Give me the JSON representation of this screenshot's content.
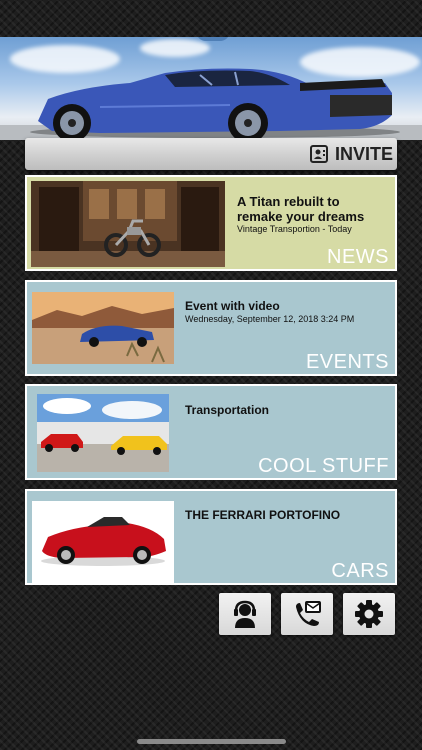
{
  "header": {
    "invite_label": "INVITE"
  },
  "feed": [
    {
      "title": "A Titan rebuilt to remake your dreams",
      "subtitle": "Vintage Transportion - Today",
      "section": "NEWS",
      "bg": "#d6dba5",
      "thumb": "motorcycle-garage-image"
    },
    {
      "title": "Event with video",
      "subtitle": "Wednesday, September 12, 2018 3:24 PM",
      "section": "EVENTS",
      "bg": "#a9c7cf",
      "thumb": "desert-supercar-image"
    },
    {
      "title": "Transportation",
      "subtitle": "",
      "section": "COOL STUFF",
      "bg": "#a9c7cf",
      "thumb": "race-cars-image"
    },
    {
      "title": "THE FERRARI PORTOFINO",
      "subtitle": "",
      "section": "CARS",
      "bg": "#a9c7cf",
      "thumb": "red-ferrari-image"
    }
  ],
  "actions": [
    {
      "icon": "headset-support-icon"
    },
    {
      "icon": "phone-mail-icon"
    },
    {
      "icon": "gear-icon"
    }
  ],
  "colors": {
    "news_bg": "#d6dba5",
    "card_bg": "#a9c7cf",
    "card_border": "#ffffff",
    "background": "#1e1e1e"
  }
}
